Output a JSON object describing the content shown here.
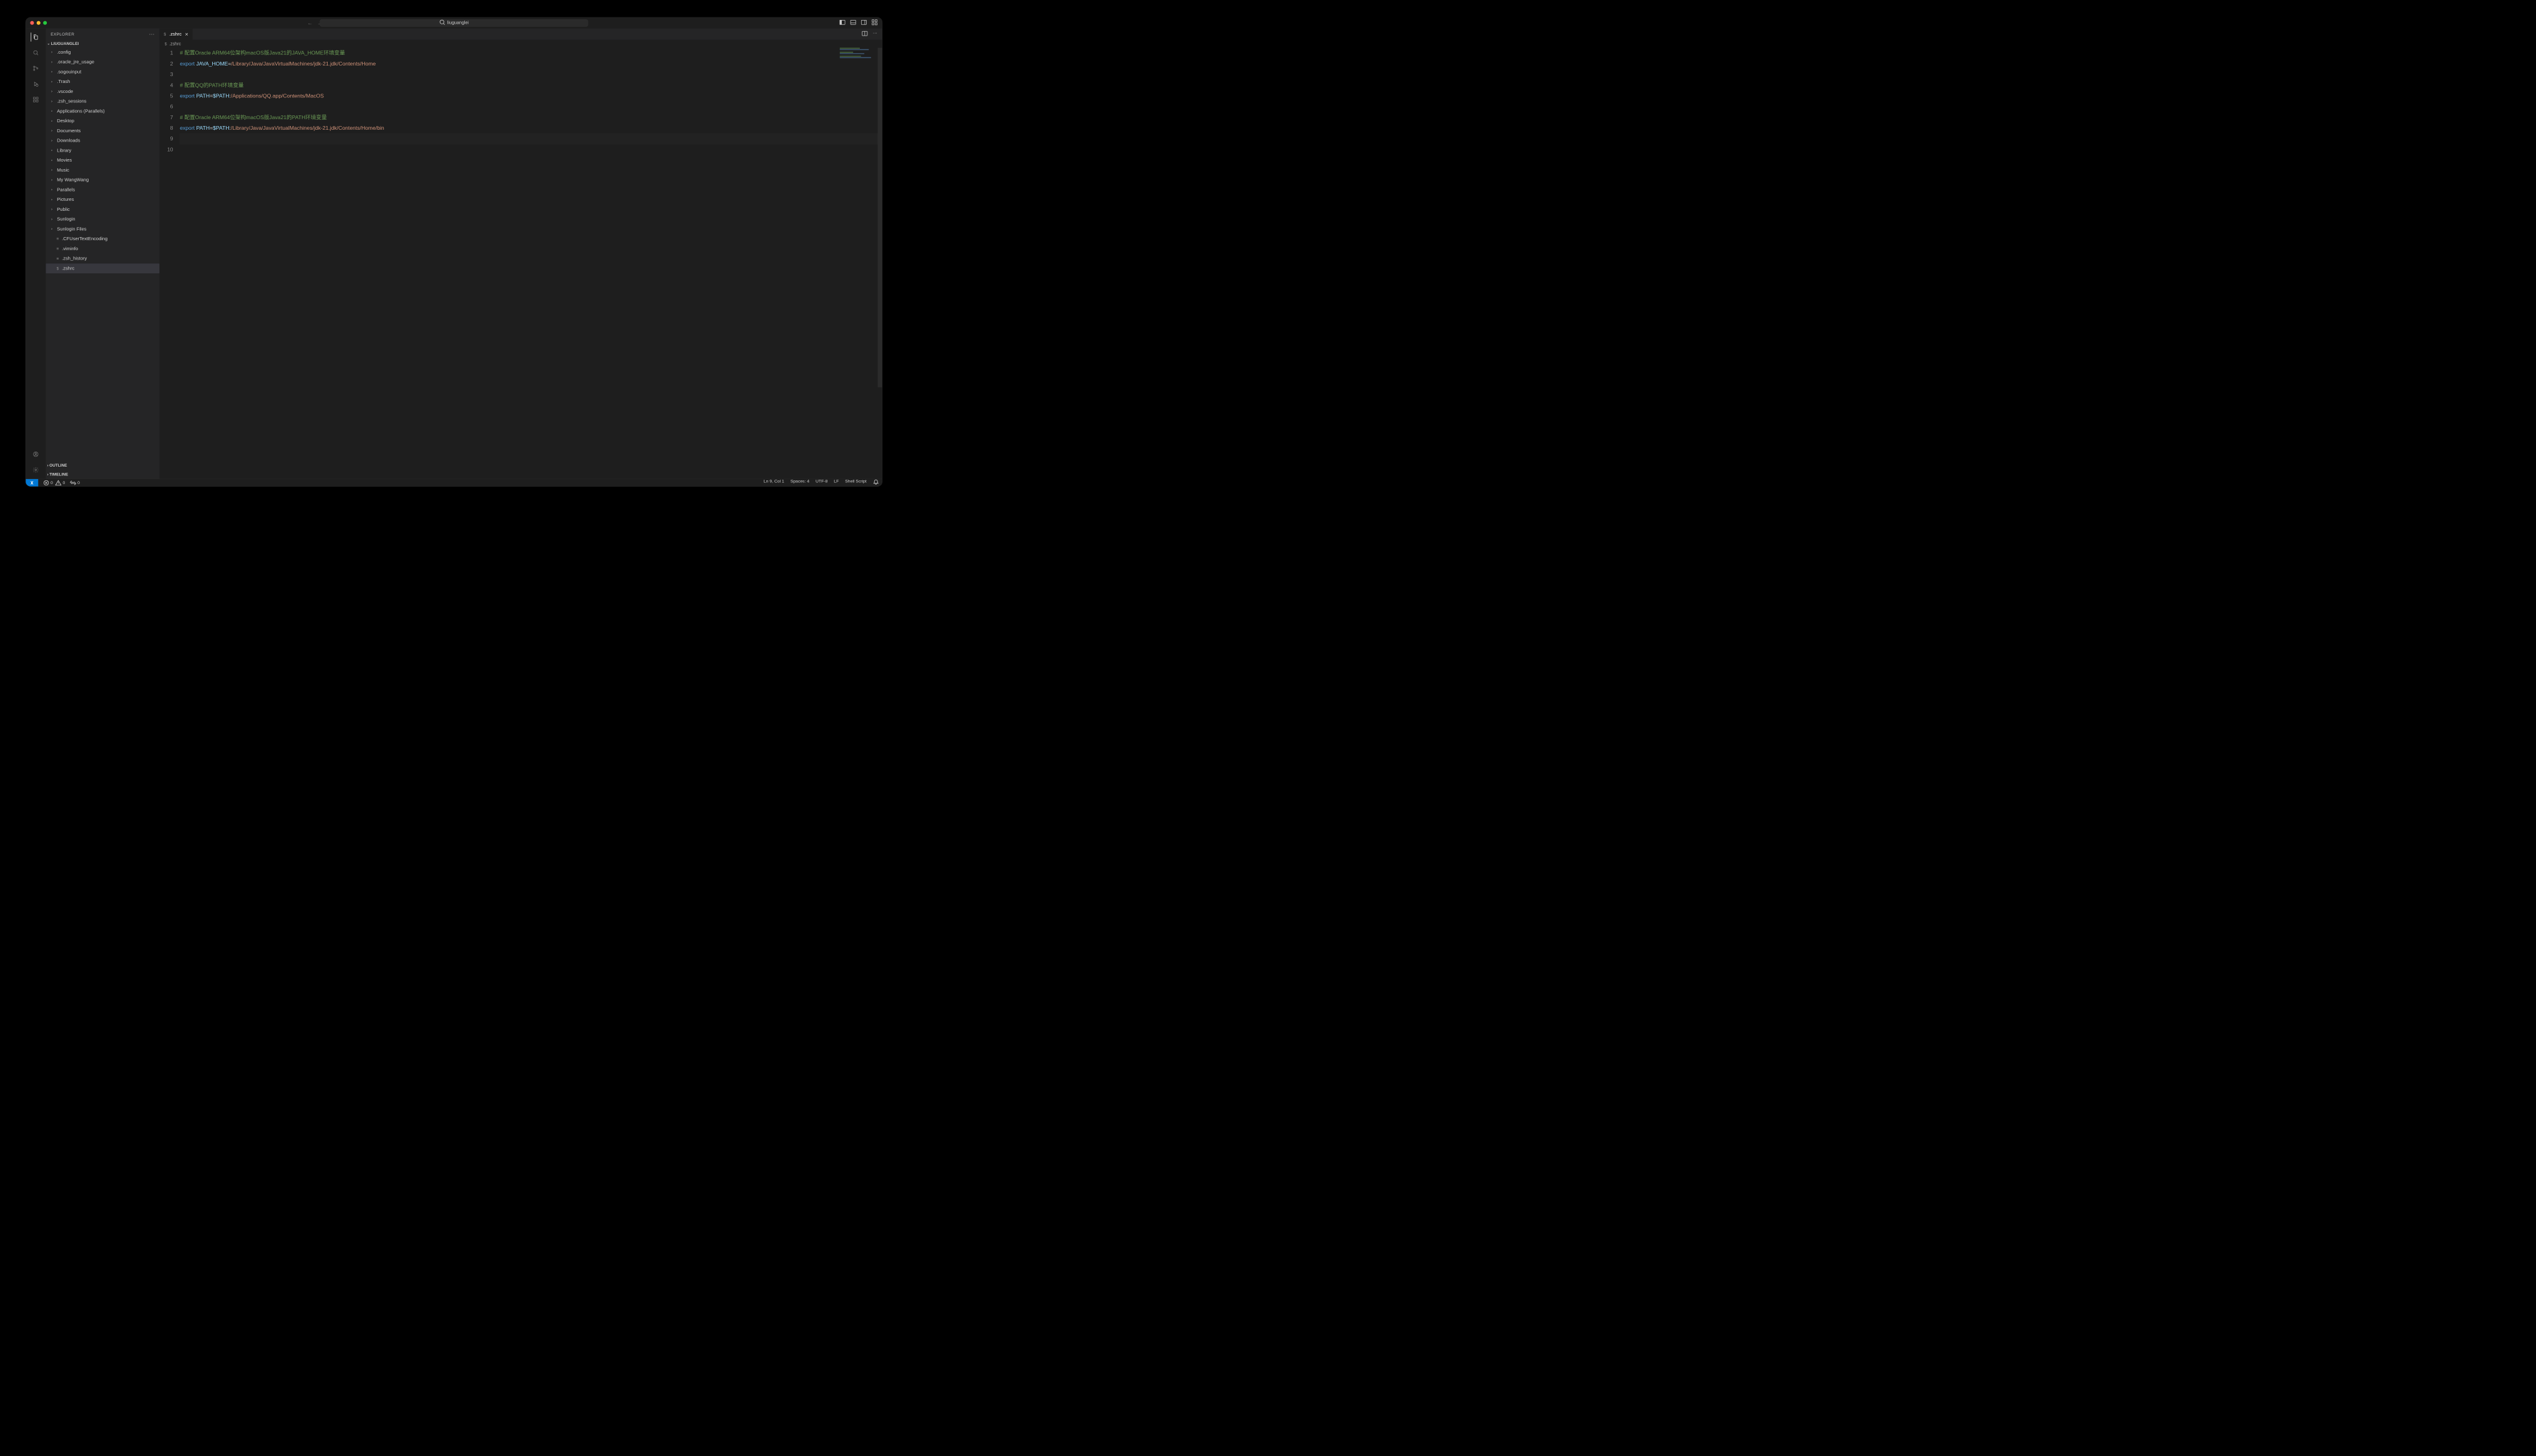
{
  "titlebar": {
    "search_text": "liuguanglei"
  },
  "sidebar": {
    "title": "EXPLORER",
    "workspace": "LIUGUANGLEI",
    "tree": [
      {
        "type": "folder",
        "label": ".config"
      },
      {
        "type": "folder",
        "label": ".oracle_jre_usage"
      },
      {
        "type": "folder",
        "label": ".sogouinput"
      },
      {
        "type": "folder",
        "label": ".Trash"
      },
      {
        "type": "folder",
        "label": ".vscode"
      },
      {
        "type": "folder",
        "label": ".zsh_sessions"
      },
      {
        "type": "folder",
        "label": "Applications (Parallels)"
      },
      {
        "type": "folder",
        "label": "Desktop"
      },
      {
        "type": "folder",
        "label": "Documents"
      },
      {
        "type": "folder",
        "label": "Downloads"
      },
      {
        "type": "folder",
        "label": "Library"
      },
      {
        "type": "folder",
        "label": "Movies"
      },
      {
        "type": "folder",
        "label": "Music"
      },
      {
        "type": "folder",
        "label": "My WangWang"
      },
      {
        "type": "folder",
        "label": "Parallels"
      },
      {
        "type": "folder",
        "label": "Pictures"
      },
      {
        "type": "folder",
        "label": "Public"
      },
      {
        "type": "folder",
        "label": "Sunlogin"
      },
      {
        "type": "folder",
        "label": "Sunlogin Files"
      },
      {
        "type": "file",
        "label": ".CFUserTextEncoding",
        "icon": "≡"
      },
      {
        "type": "file",
        "label": ".viminfo",
        "icon": "≡"
      },
      {
        "type": "file",
        "label": ".zsh_history",
        "icon": "≡"
      },
      {
        "type": "file",
        "label": ".zshrc",
        "icon": "$",
        "selected": true
      }
    ],
    "outline": "OUTLINE",
    "timeline": "TIMELINE"
  },
  "tab": {
    "label": ".zshrc",
    "icon": "$"
  },
  "breadcrumb": {
    "file": ".zshrc",
    "icon": "$"
  },
  "code": {
    "lines": [
      {
        "n": "1",
        "tokens": [
          {
            "t": "# 配置Oracle ARM64位架构macOS版Java21的JAVA_HOME环境变量",
            "c": "tok-comment"
          }
        ]
      },
      {
        "n": "2",
        "tokens": [
          {
            "t": "export",
            "c": "tok-keyword"
          },
          {
            "t": " ",
            "c": ""
          },
          {
            "t": "JAVA_HOME",
            "c": "tok-var"
          },
          {
            "t": "=",
            "c": "tok-op"
          },
          {
            "t": "/Library/Java/JavaVirtualMachines/jdk-21.jdk/Contents/Home",
            "c": "tok-path"
          }
        ]
      },
      {
        "n": "3",
        "tokens": []
      },
      {
        "n": "4",
        "tokens": [
          {
            "t": "# 配置QQ的PATH环境变量",
            "c": "tok-comment"
          }
        ]
      },
      {
        "n": "5",
        "tokens": [
          {
            "t": "export",
            "c": "tok-keyword"
          },
          {
            "t": " ",
            "c": ""
          },
          {
            "t": "PATH",
            "c": "tok-var"
          },
          {
            "t": "=",
            "c": "tok-op"
          },
          {
            "t": "$PATH",
            "c": "tok-var"
          },
          {
            "t": ":",
            "c": "tok-op"
          },
          {
            "t": "/Applications/QQ.app/Contents/MacOS",
            "c": "tok-path"
          }
        ]
      },
      {
        "n": "6",
        "tokens": []
      },
      {
        "n": "7",
        "tokens": [
          {
            "t": "# 配置Oracle ARM64位架构macOS版Java21的PATH环境变量",
            "c": "tok-comment"
          }
        ]
      },
      {
        "n": "8",
        "tokens": [
          {
            "t": "export",
            "c": "tok-keyword"
          },
          {
            "t": " ",
            "c": ""
          },
          {
            "t": "PATH",
            "c": "tok-var"
          },
          {
            "t": "=",
            "c": "tok-op"
          },
          {
            "t": "$PATH",
            "c": "tok-var"
          },
          {
            "t": ":",
            "c": "tok-op"
          },
          {
            "t": "/Library/Java/JavaVirtualMachines/jdk-21.jdk/Contents/Home/bin",
            "c": "tok-path"
          }
        ]
      },
      {
        "n": "9",
        "tokens": [],
        "cursor": true
      },
      {
        "n": "10",
        "tokens": []
      }
    ]
  },
  "statusbar": {
    "errors": "0",
    "warnings": "0",
    "ports_label": "0",
    "cursor": "Ln 9, Col 1",
    "spaces": "Spaces: 4",
    "encoding": "UTF-8",
    "eol": "LF",
    "lang": "Shell Script"
  }
}
